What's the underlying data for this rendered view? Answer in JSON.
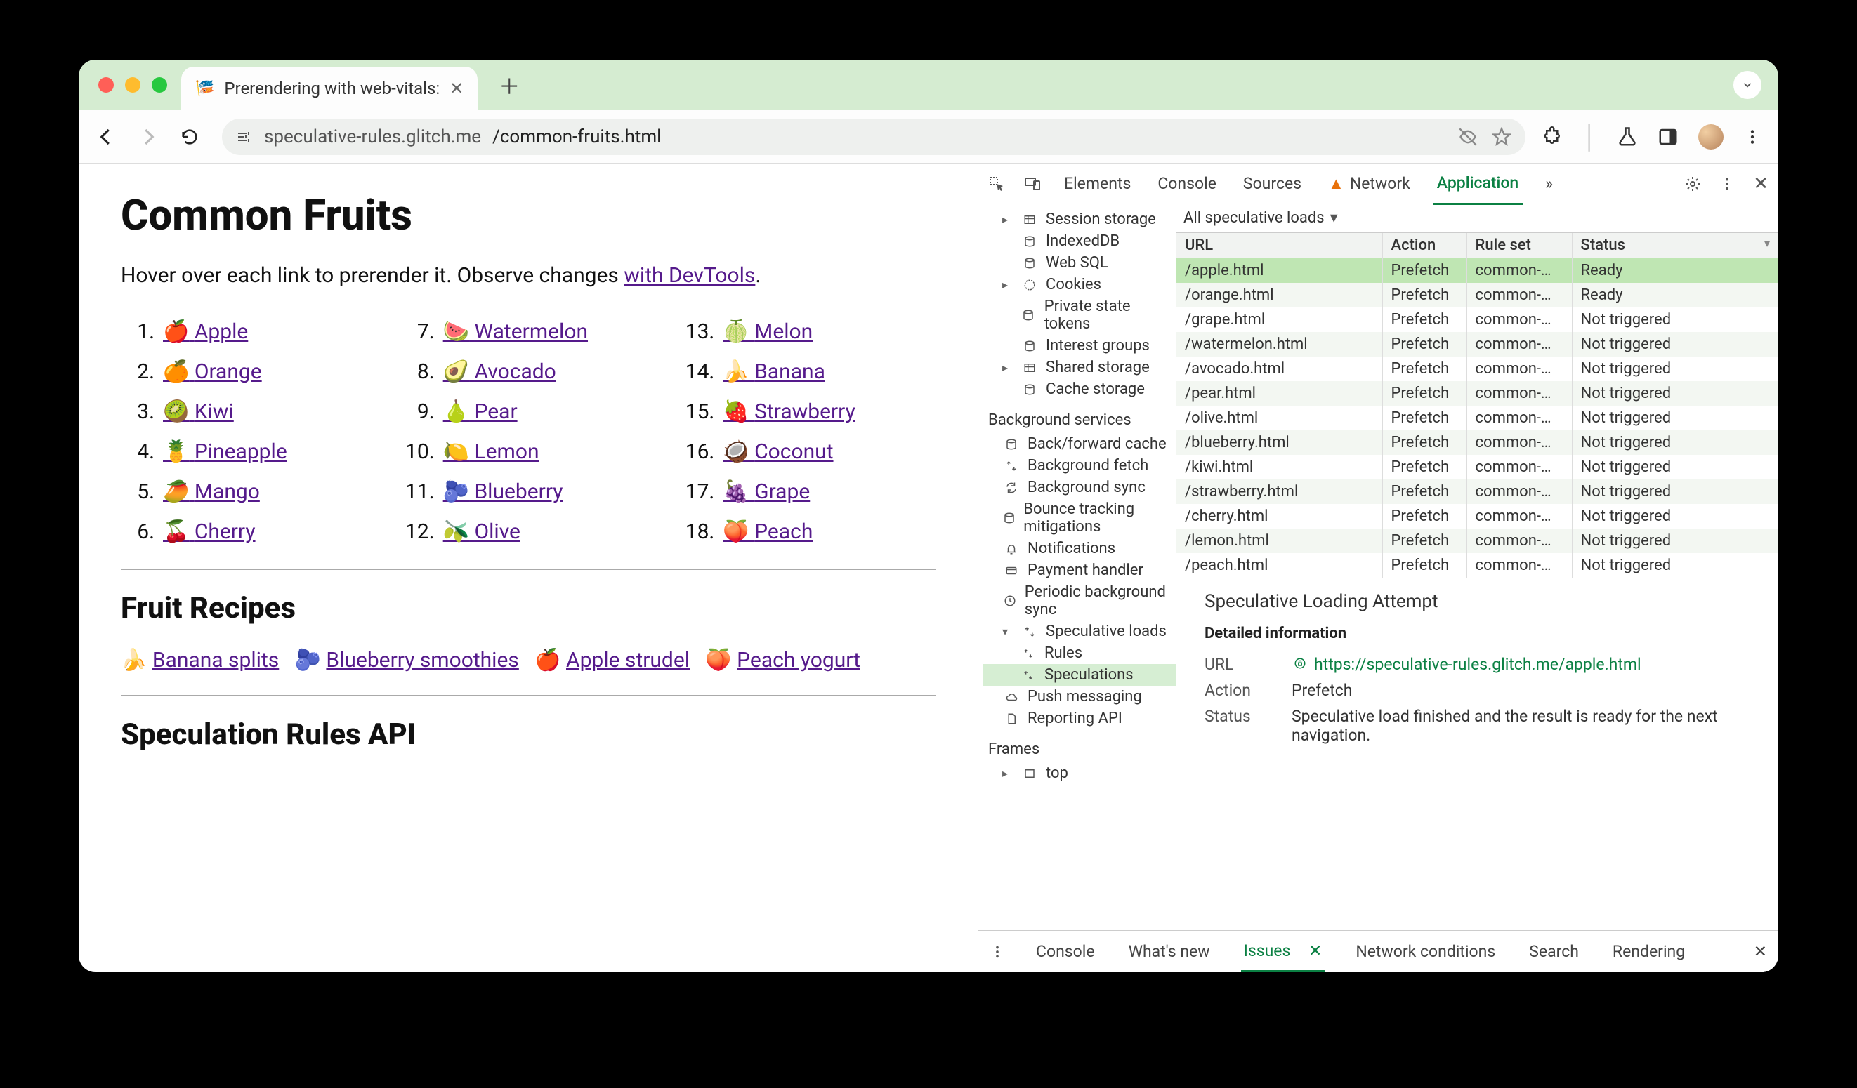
{
  "chrome": {
    "tab_title": "Prerendering with web-vitals:",
    "url_host": "speculative-rules.glitch.me",
    "url_path": "/common-fruits.html"
  },
  "page": {
    "h1": "Common Fruits",
    "intro_a": "Hover over each link to prerender it. Observe changes ",
    "intro_link": "with DevTools",
    "intro_b": ".",
    "fruits": [
      {
        "n": "1.",
        "e": "🍎",
        "t": "Apple"
      },
      {
        "n": "2.",
        "e": "🍊",
        "t": "Orange"
      },
      {
        "n": "3.",
        "e": "🥝",
        "t": "Kiwi"
      },
      {
        "n": "4.",
        "e": "🍍",
        "t": "Pineapple"
      },
      {
        "n": "5.",
        "e": "🥭",
        "t": "Mango"
      },
      {
        "n": "6.",
        "e": "🍒",
        "t": "Cherry"
      },
      {
        "n": "7.",
        "e": "🍉",
        "t": "Watermelon"
      },
      {
        "n": "8.",
        "e": "🥑",
        "t": "Avocado"
      },
      {
        "n": "9.",
        "e": "🍐",
        "t": "Pear"
      },
      {
        "n": "10.",
        "e": "🍋",
        "t": "Lemon"
      },
      {
        "n": "11.",
        "e": "🫐",
        "t": "Blueberry"
      },
      {
        "n": "12.",
        "e": "🫒",
        "t": "Olive"
      },
      {
        "n": "13.",
        "e": "🍈",
        "t": "Melon"
      },
      {
        "n": "14.",
        "e": "🍌",
        "t": "Banana"
      },
      {
        "n": "15.",
        "e": "🍓",
        "t": "Strawberry"
      },
      {
        "n": "16.",
        "e": "🥥",
        "t": "Coconut"
      },
      {
        "n": "17.",
        "e": "🍇",
        "t": "Grape"
      },
      {
        "n": "18.",
        "e": "🍑",
        "t": "Peach"
      }
    ],
    "h2_recipes": "Fruit Recipes",
    "recipes": [
      {
        "e": "🍌",
        "t": "Banana splits"
      },
      {
        "e": "🫐",
        "t": "Blueberry smoothies"
      },
      {
        "e": "🍎",
        "t": "Apple strudel"
      },
      {
        "e": "🍑",
        "t": "Peach yogurt"
      }
    ],
    "h2_api": "Speculation Rules API"
  },
  "devtools": {
    "tabs": {
      "elements": "Elements",
      "console": "Console",
      "sources": "Sources",
      "network": "Network",
      "application": "Application",
      "more": "»"
    },
    "app_tree": {
      "session_storage": "Session storage",
      "indexeddb": "IndexedDB",
      "web_sql": "Web SQL",
      "cookies": "Cookies",
      "private_state_tokens": "Private state tokens",
      "interest_groups": "Interest groups",
      "shared_storage": "Shared storage",
      "cache_storage": "Cache storage",
      "bg_heading": "Background services",
      "back_forward": "Back/forward cache",
      "bg_fetch": "Background fetch",
      "bg_sync": "Background sync",
      "bounce": "Bounce tracking mitigations",
      "notifications": "Notifications",
      "payment": "Payment handler",
      "periodic": "Periodic background sync",
      "spec_loads": "Speculative loads",
      "rules": "Rules",
      "speculations": "Speculations",
      "push": "Push messaging",
      "reporting": "Reporting API",
      "frames_heading": "Frames",
      "top": "top"
    },
    "filter_label": "All speculative loads",
    "columns": {
      "url": "URL",
      "action": "Action",
      "ruleset": "Rule set",
      "status": "Status"
    },
    "rows": [
      {
        "url": "/apple.html",
        "action": "Prefetch",
        "ruleset": "common-…",
        "status": "Ready",
        "selected": true
      },
      {
        "url": "/orange.html",
        "action": "Prefetch",
        "ruleset": "common-…",
        "status": "Ready"
      },
      {
        "url": "/grape.html",
        "action": "Prefetch",
        "ruleset": "common-…",
        "status": "Not triggered"
      },
      {
        "url": "/watermelon.html",
        "action": "Prefetch",
        "ruleset": "common-…",
        "status": "Not triggered"
      },
      {
        "url": "/avocado.html",
        "action": "Prefetch",
        "ruleset": "common-…",
        "status": "Not triggered"
      },
      {
        "url": "/pear.html",
        "action": "Prefetch",
        "ruleset": "common-…",
        "status": "Not triggered"
      },
      {
        "url": "/olive.html",
        "action": "Prefetch",
        "ruleset": "common-…",
        "status": "Not triggered"
      },
      {
        "url": "/blueberry.html",
        "action": "Prefetch",
        "ruleset": "common-…",
        "status": "Not triggered"
      },
      {
        "url": "/kiwi.html",
        "action": "Prefetch",
        "ruleset": "common-…",
        "status": "Not triggered"
      },
      {
        "url": "/strawberry.html",
        "action": "Prefetch",
        "ruleset": "common-…",
        "status": "Not triggered"
      },
      {
        "url": "/cherry.html",
        "action": "Prefetch",
        "ruleset": "common-…",
        "status": "Not triggered"
      },
      {
        "url": "/lemon.html",
        "action": "Prefetch",
        "ruleset": "common-…",
        "status": "Not triggered"
      },
      {
        "url": "/peach.html",
        "action": "Prefetch",
        "ruleset": "common-…",
        "status": "Not triggered"
      }
    ],
    "detail": {
      "title": "Speculative Loading Attempt",
      "section": "Detailed information",
      "url_k": "URL",
      "url_v": "https://speculative-rules.glitch.me/apple.html",
      "action_k": "Action",
      "action_v": "Prefetch",
      "status_k": "Status",
      "status_v": "Speculative load finished and the result is ready for the next navigation."
    },
    "drawer": {
      "console": "Console",
      "whatsnew": "What's new",
      "issues": "Issues",
      "network_conditions": "Network conditions",
      "search": "Search",
      "rendering": "Rendering"
    }
  }
}
